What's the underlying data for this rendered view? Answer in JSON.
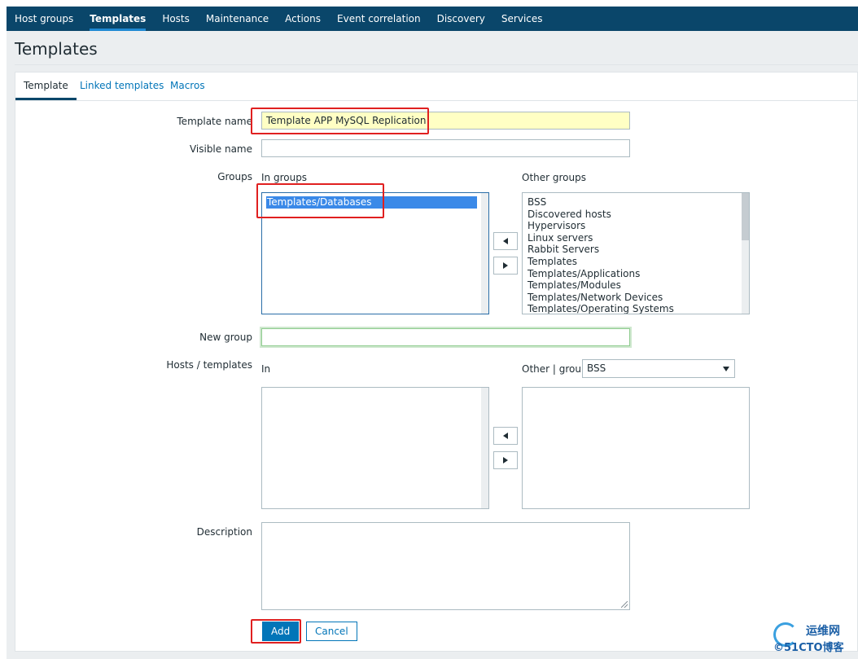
{
  "nav": {
    "items": [
      {
        "label": "Host groups"
      },
      {
        "label": "Templates",
        "active": true
      },
      {
        "label": "Hosts"
      },
      {
        "label": "Maintenance"
      },
      {
        "label": "Actions"
      },
      {
        "label": "Event correlation"
      },
      {
        "label": "Discovery"
      },
      {
        "label": "Services"
      }
    ]
  },
  "page": {
    "title": "Templates"
  },
  "tabs": [
    {
      "label": "Template",
      "active": true
    },
    {
      "label": "Linked templates"
    },
    {
      "label": "Macros"
    }
  ],
  "form": {
    "template_name": {
      "label": "Template name",
      "value": "Template APP MySQL Replication"
    },
    "visible_name": {
      "label": "Visible name",
      "value": ""
    },
    "groups": {
      "label": "Groups",
      "in_label": "In groups",
      "other_label": "Other groups",
      "in_items": [
        "Templates/Databases"
      ],
      "selected_in": "Templates/Databases",
      "other_items": [
        "BSS",
        "Discovered hosts",
        "Hypervisors",
        "Linux servers",
        "Rabbit Servers",
        "Templates",
        "Templates/Applications",
        "Templates/Modules",
        "Templates/Network Devices",
        "Templates/Operating Systems"
      ]
    },
    "new_group": {
      "label": "New group",
      "value": ""
    },
    "hosts_templates": {
      "label": "Hosts / templates",
      "in_label": "In",
      "other_label": "Other | group",
      "group_select": "BSS",
      "in_items": [],
      "other_items": []
    },
    "description": {
      "label": "Description",
      "value": ""
    },
    "buttons": {
      "add": "Add",
      "cancel": "Cancel"
    }
  },
  "watermark": {
    "line1": "运维网",
    "line2": "©51CTO博客"
  },
  "colors": {
    "nav_bg": "#0a466a",
    "accent": "#0275b8",
    "highlight": "#e02020",
    "filled_field": "#ffffc4"
  }
}
